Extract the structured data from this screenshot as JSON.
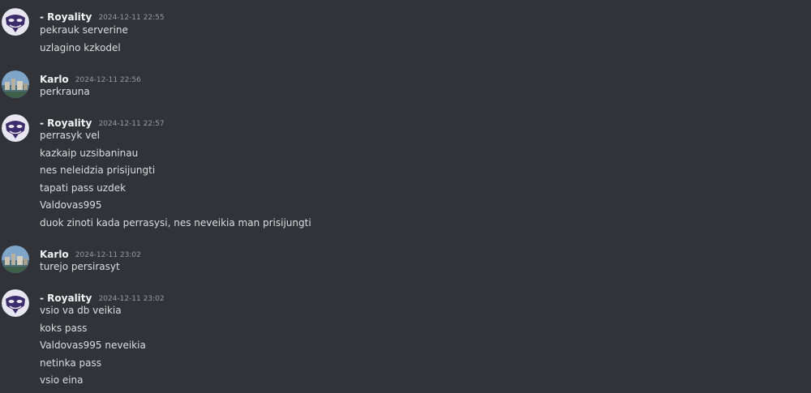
{
  "messages": [
    {
      "author": "- Royality",
      "time": "2024-12-11 22:55",
      "avatar": "mask-icon",
      "lines": [
        "pekrauk serverine",
        "uzlagino kzkodel"
      ]
    },
    {
      "author": "Karlo",
      "time": "2024-12-11 22:56",
      "avatar": "landscape-icon",
      "lines": [
        "perkrauna"
      ]
    },
    {
      "author": "- Royality",
      "time": "2024-12-11 22:57",
      "avatar": "mask-icon",
      "lines": [
        "perrasyk vel",
        "kazkaip uzsibaninau",
        "nes neleidzia prisijungti",
        "tapati pass uzdek",
        "Valdovas995",
        "duok zinoti kada perrasysi, nes neveikia man prisijungti"
      ]
    },
    {
      "author": "Karlo",
      "time": "2024-12-11 23:02",
      "avatar": "landscape-icon",
      "lines": [
        "turejo persirasyt"
      ]
    },
    {
      "author": "- Royality",
      "time": "2024-12-11 23:02",
      "avatar": "mask-icon",
      "lines": [
        "vsio va db veikia",
        "koks pass",
        "Valdovas995 neveikia",
        "netinka pass",
        "vsio eina"
      ]
    }
  ],
  "colors": {
    "background": "#313338",
    "username": "#f2f3f5",
    "timestamp": "#949ba4",
    "text": "#dbdee1"
  }
}
